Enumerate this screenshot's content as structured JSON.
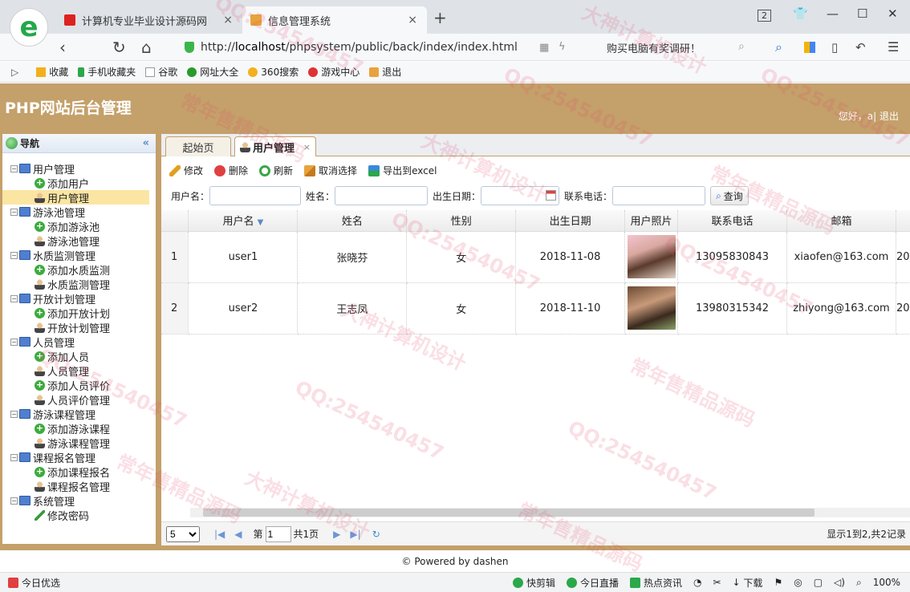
{
  "browser": {
    "tabs": [
      {
        "title": "计算机专业毕业设计源码网",
        "close": "×"
      },
      {
        "title": "信息管理系统",
        "close": "×"
      }
    ],
    "new_tab": "+",
    "tab_count": "2",
    "url_prefix": "http://",
    "url_host": "localhost",
    "url_path": "/phpsystem/public/back/index/index.html",
    "ad_text": "购买电脑有奖调研！",
    "bookmarks": [
      "收藏",
      "手机收藏夹",
      "谷歌",
      "网址大全",
      "360搜索",
      "游戏中心",
      "退出"
    ],
    "status_left": "今日优选",
    "status_items": [
      "快剪辑",
      "今日直播",
      "热点资讯",
      "下载"
    ],
    "zoom": "100%"
  },
  "app": {
    "title": "PHP网站后台管理",
    "greeting": "您好，a| 退出",
    "footer": "© Powered by dashen"
  },
  "sidebar": {
    "title": "导航",
    "collapse": "«",
    "groups": [
      {
        "label": "用户管理",
        "items": [
          "添加用户",
          "用户管理"
        ]
      },
      {
        "label": "游泳池管理",
        "items": [
          "添加游泳池",
          "游泳池管理"
        ]
      },
      {
        "label": "水质监测管理",
        "items": [
          "添加水质监测",
          "水质监测管理"
        ]
      },
      {
        "label": "开放计划管理",
        "items": [
          "添加开放计划",
          "开放计划管理"
        ]
      },
      {
        "label": "人员管理",
        "items": [
          "添加人员",
          "人员管理",
          "添加人员评价",
          "人员评价管理"
        ]
      },
      {
        "label": "游泳课程管理",
        "items": [
          "添加游泳课程",
          "游泳课程管理"
        ]
      },
      {
        "label": "课程报名管理",
        "items": [
          "添加课程报名",
          "课程报名管理"
        ]
      },
      {
        "label": "系统管理",
        "items": [
          "修改密码"
        ]
      }
    ]
  },
  "page_tabs": [
    {
      "label": "起始页"
    },
    {
      "label": "用户管理",
      "close": "×"
    }
  ],
  "toolbar": {
    "edit": "修改",
    "delete": "删除",
    "refresh": "刷新",
    "unselect": "取消选择",
    "export": "导出到excel"
  },
  "search": {
    "username_label": "用户名：",
    "name_label": "姓名：",
    "birth_label": "出生日期：",
    "phone_label": "联系电话：",
    "query_button": "查询"
  },
  "table": {
    "columns": [
      "",
      "用户名",
      "姓名",
      "性别",
      "出生日期",
      "用户照片",
      "联系电话",
      "邮箱",
      ""
    ],
    "sort_indicator": "▼",
    "rows": [
      {
        "num": "1",
        "username": "user1",
        "name": "张晓芬",
        "gender": "女",
        "birth": "2018-11-08",
        "phone": "13095830843",
        "email": "xiaofen@163.com",
        "extra": "20"
      },
      {
        "num": "2",
        "username": "user2",
        "name": "王志凤",
        "gender": "女",
        "birth": "2018-11-10",
        "phone": "13980315342",
        "email": "zhiyong@163.com",
        "extra": "20"
      }
    ]
  },
  "pager": {
    "page_size": "5",
    "page_prefix": "第",
    "page": "1",
    "page_suffix": "共1页",
    "info": "显示1到2,共2记录"
  },
  "watermarks": [
    "QQ:254540457",
    "常年售精品源码",
    "大神计算机设计"
  ],
  "colors": {
    "accent": "#c4a06a",
    "selection": "#fbe5a2"
  }
}
